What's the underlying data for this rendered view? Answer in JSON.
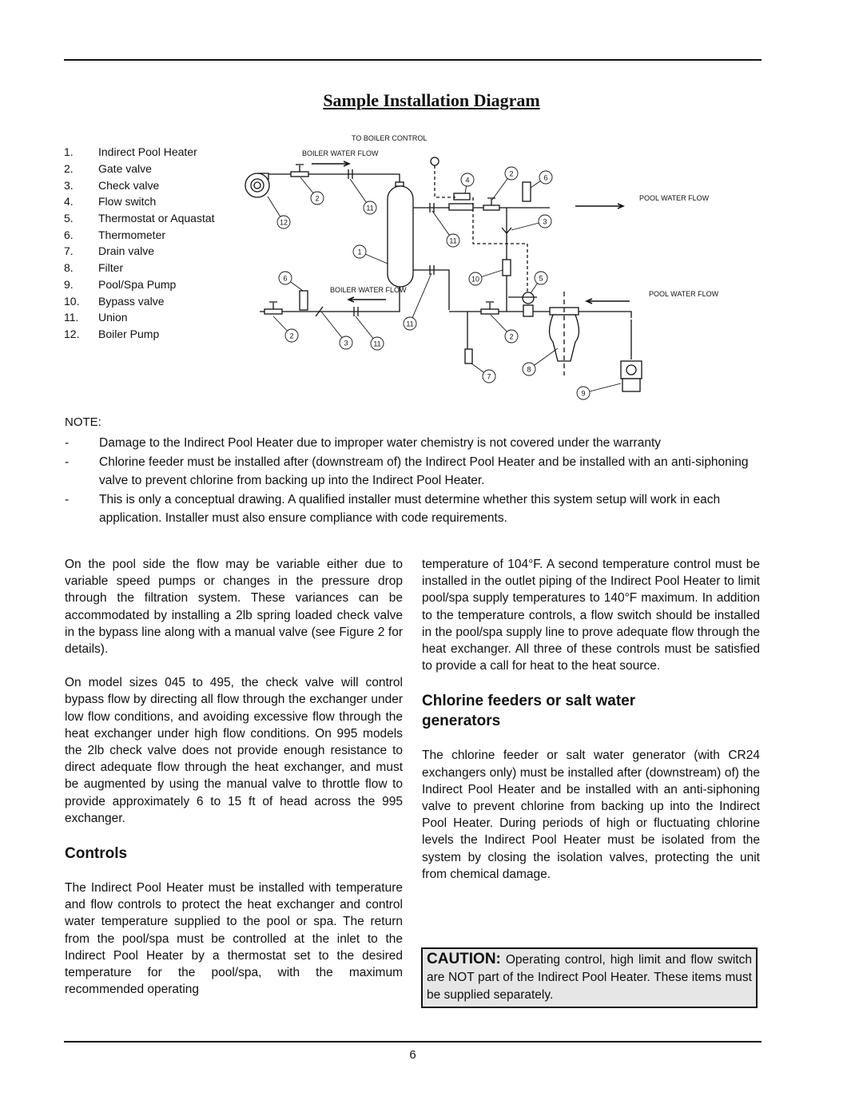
{
  "title": "Sample Installation Diagram",
  "legend": [
    {
      "num": "1.",
      "label": "Indirect Pool Heater"
    },
    {
      "num": "2.",
      "label": "Gate valve"
    },
    {
      "num": "3.",
      "label": "Check valve"
    },
    {
      "num": "4.",
      "label": "Flow switch"
    },
    {
      "num": "5.",
      "label": "Thermostat or Aquastat"
    },
    {
      "num": "6.",
      "label": "Thermometer"
    },
    {
      "num": "7.",
      "label": "Drain valve"
    },
    {
      "num": "8.",
      "label": "Filter"
    },
    {
      "num": "9.",
      "label": "Pool/Spa Pump"
    },
    {
      "num": "10.",
      "label": "Bypass valve"
    },
    {
      "num": "11.",
      "label": "Union"
    },
    {
      "num": "12.",
      "label": "Boiler Pump"
    }
  ],
  "diagram": {
    "to_boiler_control": "TO BOILER CONTROL",
    "boiler_flow_top": "BOILER WATER FLOW",
    "boiler_flow_bottom": "BOILER WATER FLOW",
    "pool_flow_top": "POOL WATER FLOW",
    "pool_flow_bottom": "POOL WATER FLOW",
    "callouts": [
      "12",
      "2",
      "11",
      "4",
      "2",
      "6",
      "3",
      "11",
      "1",
      "10",
      "5",
      "6",
      "2",
      "3",
      "11",
      "11",
      "2",
      "7",
      "8",
      "9"
    ]
  },
  "note": {
    "heading": "NOTE:",
    "items": [
      {
        "dash": "-",
        "text": "Damage to the Indirect Pool Heater due to improper water chemistry is not covered under the warranty"
      },
      {
        "dash": "-",
        "text": "Chlorine feeder must be installed after (downstream of) the Indirect Pool Heater and be installed with an anti-siphoning valve to prevent chlorine from backing up into the Indirect Pool Heater."
      },
      {
        "dash": "-",
        "text": "This is only a conceptual drawing. A qualified installer must determine whether this system setup will work in each application. Installer must also ensure compliance with code requirements."
      }
    ]
  },
  "left_col": {
    "p1": "On the pool side the flow may be variable either due to variable speed pumps or changes in the pressure drop through the filtration system.  These variances can be accommodated by installing a 2lb spring loaded check valve in the bypass line along with a manual valve (see Figure 2 for details).",
    "p2": "On model sizes 045 to 495, the check valve will control bypass flow by directing all flow through the exchanger under low flow conditions, and avoiding excessive flow through the heat exchanger under high flow conditions.  On 995 models the 2lb check valve does not provide enough resistance to direct adequate flow through the heat exchanger, and must be augmented by using the manual valve to throttle flow to provide approximately 6 to 15 ft of head across the 995 exchanger.",
    "controls_heading": "Controls",
    "p3": "The Indirect Pool Heater must be installed with temperature and flow controls to protect the heat exchanger and control water temperature supplied to the pool or spa.  The return from the pool/spa must be controlled at the inlet to the Indirect Pool Heater by a thermostat set to the desired temperature for the pool/spa, with the maximum recommended operating"
  },
  "right_col": {
    "p1": "temperature of 104°F.  A second temperature control must be installed in the outlet piping of the Indirect Pool Heater to limit pool/spa supply temperatures to 140°F maximum.  In addition to the temperature controls, a flow switch should be installed in the pool/spa supply line to prove adequate flow through the heat exchanger.  All three of these controls must be satisfied to provide a call for heat to the heat source.",
    "heading": "Chlorine feeders or salt water generators",
    "p2": "The chlorine feeder or salt water generator (with CR24 exchangers only) must be installed after (downstream) of) the Indirect Pool Heater and be installed with an anti-siphoning valve to prevent chlorine from backing up into the Indirect Pool Heater.  During periods of high or fluctuating chlorine levels the Indirect Pool Heater must be isolated from the system by closing the isolation valves, protecting the unit from chemical damage."
  },
  "caution": {
    "label": "CAUTION:",
    "text": "Operating control, high limit and flow switch are NOT part of the Indirect Pool Heater. These items must be supplied separately."
  },
  "page_number": "6"
}
